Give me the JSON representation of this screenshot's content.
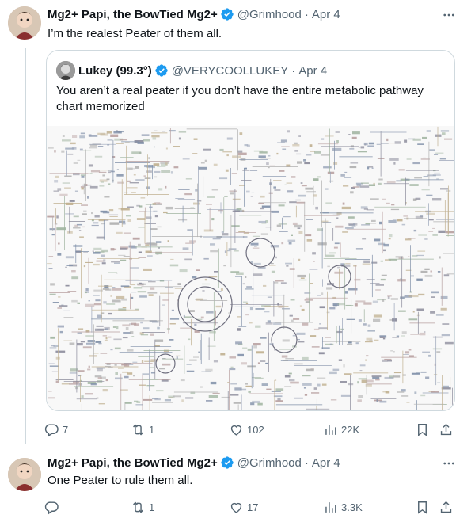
{
  "tweet1": {
    "display_name": "Mg2+ Papi, the BowTied Mg2+",
    "handle": "@Grimhood",
    "separator": "·",
    "date": "Apr 4",
    "text": "I’m the realest Peater of them all.",
    "quote": {
      "display_name": "Lukey (99.3°)",
      "handle": "@VERYCOOLLUKEY",
      "separator": "·",
      "date": "Apr 4",
      "text": "You aren’t a real peater if you don’t have the entire metabolic pathway chart memorized"
    },
    "actions": {
      "replies": "7",
      "reposts": "1",
      "likes": "102",
      "views": "22K"
    }
  },
  "tweet2": {
    "display_name": "Mg2+ Papi, the BowTied Mg2+",
    "handle": "@Grimhood",
    "separator": "·",
    "date": "Apr 4",
    "text": "One Peater to rule them all.",
    "actions": {
      "replies": "",
      "reposts": "1",
      "likes": "17",
      "views": "3.3K"
    }
  },
  "colors": {
    "verified": "#1d9bf0",
    "secondary_text": "#536471",
    "border": "#cfd9de"
  },
  "icons": [
    "verified-badge-icon",
    "more-icon",
    "reply-icon",
    "repost-icon",
    "like-icon",
    "views-icon",
    "bookmark-icon",
    "share-icon"
  ]
}
